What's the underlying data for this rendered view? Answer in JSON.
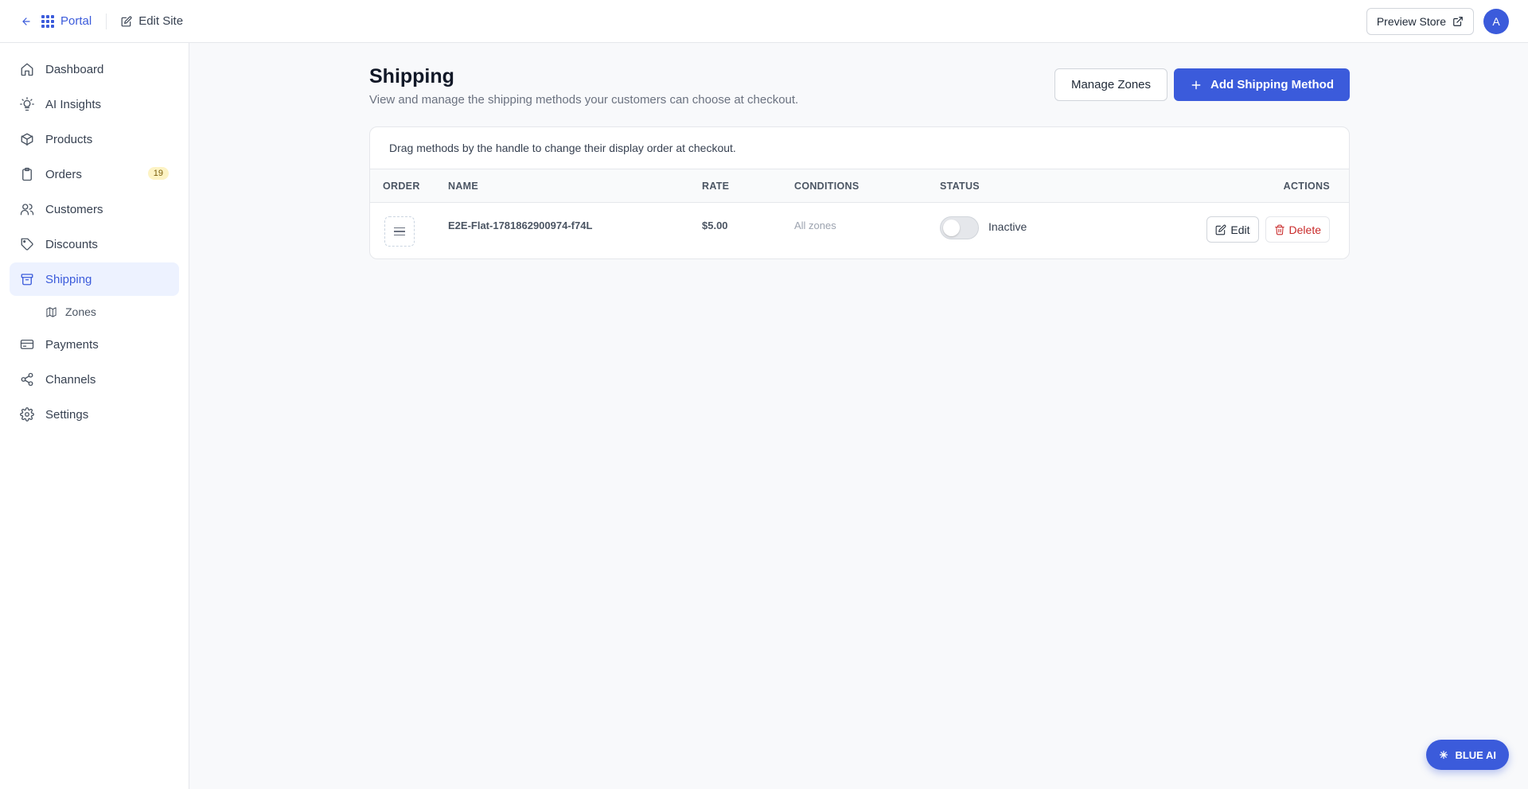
{
  "topbar": {
    "portal_label": "Portal",
    "edit_site_label": "Edit Site",
    "preview_store_label": "Preview Store",
    "avatar_initial": "A"
  },
  "sidebar": {
    "items": [
      {
        "label": "Dashboard",
        "icon": "home-icon"
      },
      {
        "label": "AI Insights",
        "icon": "lightbulb-icon"
      },
      {
        "label": "Products",
        "icon": "box-icon"
      },
      {
        "label": "Orders",
        "icon": "clipboard-icon",
        "badge": "19"
      },
      {
        "label": "Customers",
        "icon": "users-icon"
      },
      {
        "label": "Discounts",
        "icon": "tag-icon"
      },
      {
        "label": "Shipping",
        "icon": "archive-icon",
        "active": true
      },
      {
        "label": "Payments",
        "icon": "credit-card-icon"
      },
      {
        "label": "Channels",
        "icon": "share-icon"
      },
      {
        "label": "Settings",
        "icon": "gear-icon"
      }
    ],
    "sub_items": [
      {
        "label": "Zones",
        "icon": "map-icon"
      }
    ]
  },
  "page": {
    "title": "Shipping",
    "subtitle": "View and manage the shipping methods your customers can choose at checkout.",
    "manage_zones_label": "Manage Zones",
    "add_method_label": "Add Shipping Method",
    "hint": "Drag methods by the handle to change their display order at checkout."
  },
  "table": {
    "headers": {
      "order": "ORDER",
      "name": "NAME",
      "rate": "RATE",
      "conditions": "CONDITIONS",
      "status": "STATUS",
      "actions": "ACTIONS"
    },
    "rows": [
      {
        "name": "E2E-Flat-1781862900974-f74L",
        "rate": "$5.00",
        "conditions": "All zones",
        "status": "Inactive",
        "active": false,
        "edit_label": "Edit",
        "delete_label": "Delete"
      }
    ]
  },
  "assistant": {
    "label": "BLUE AI"
  },
  "colors": {
    "accent": "#3b5bdb",
    "danger": "#c92a2a",
    "badge_bg": "#fdf3c4"
  }
}
